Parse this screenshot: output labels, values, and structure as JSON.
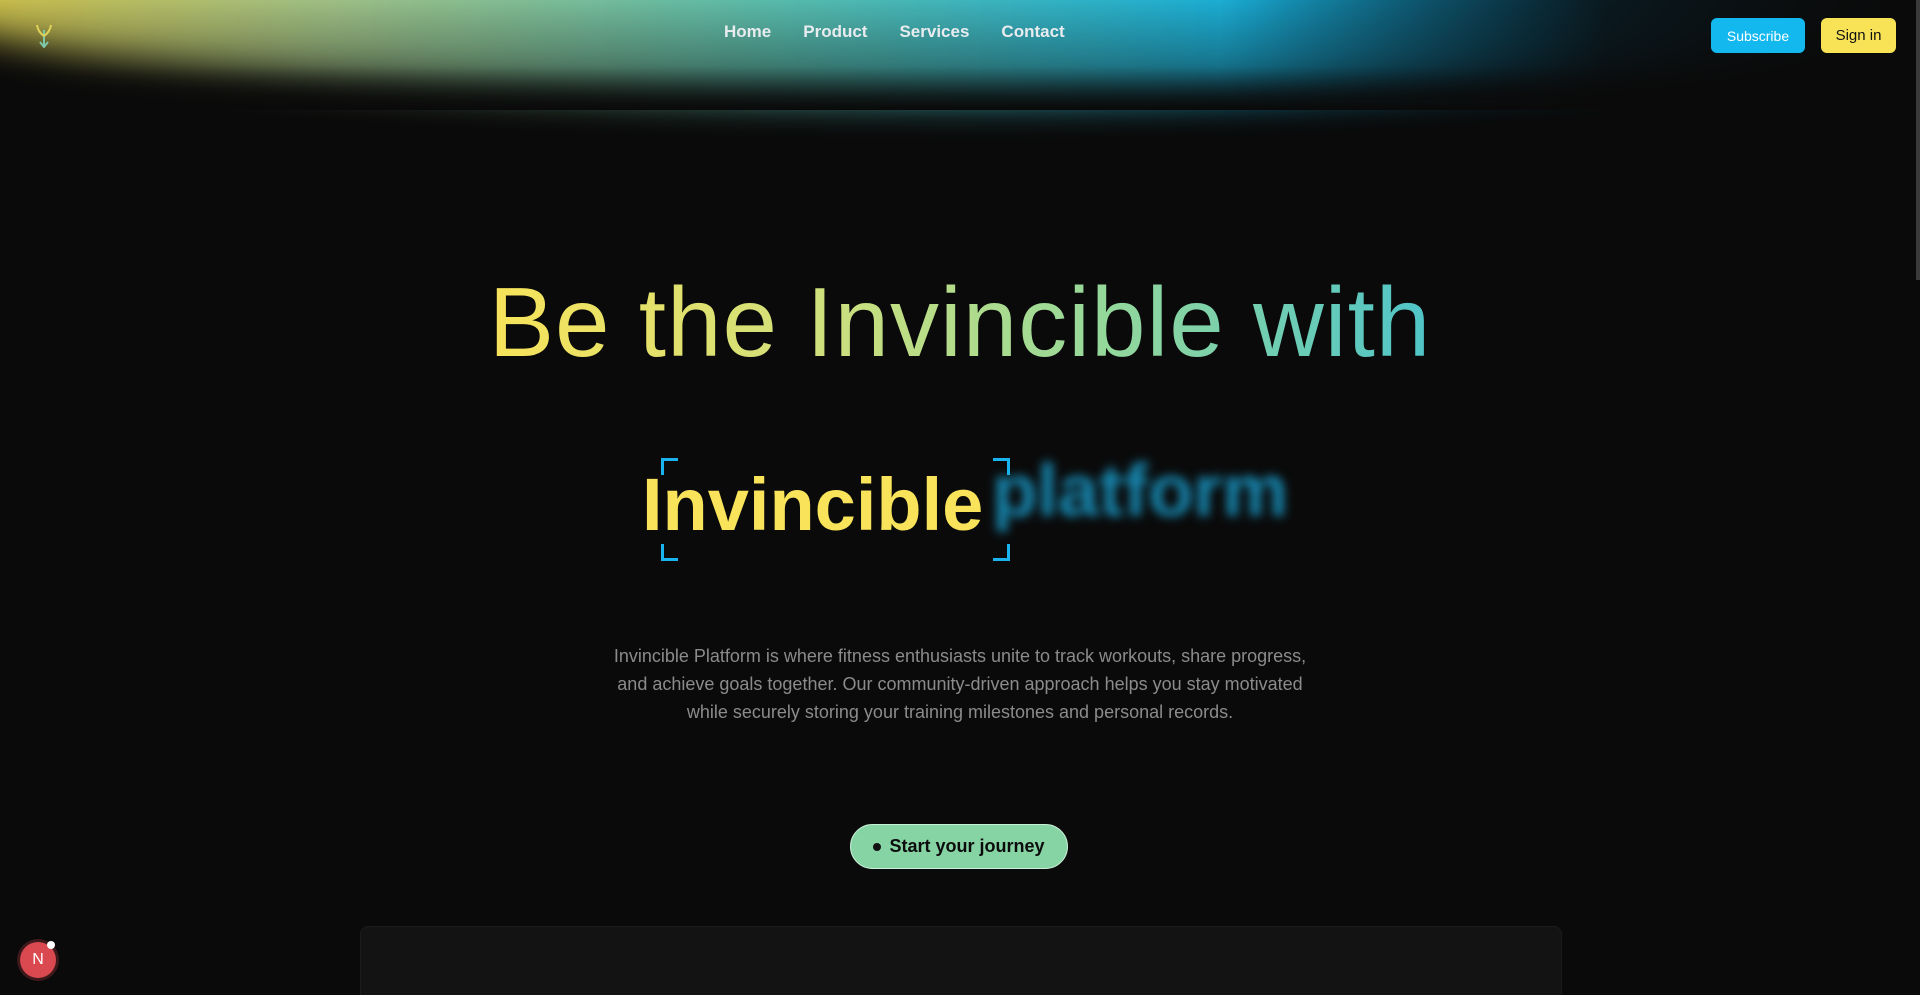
{
  "nav": {
    "logo_icon": "sprout-arrow-icon",
    "links": [
      "Home",
      "Product",
      "Services",
      "Contact"
    ],
    "subscribe_label": "Subscribe",
    "signin_label": "Sign in"
  },
  "hero": {
    "title": "Be the Invincible with",
    "rotating_word_active": "Invincible",
    "rotating_word_next": "platform",
    "description": "Invincible Platform is where fitness enthusiasts unite to track workouts, share progress, and achieve goals together. Our community-driven approach helps you stay motivated while securely storing your training milestones and personal records.",
    "cta_label": "Start your journey"
  },
  "badge": {
    "letter": "N"
  },
  "colors": {
    "background": "#0a0a0a",
    "accent_yellow": "#f8e35a",
    "accent_cyan": "#13b8ef",
    "accent_green": "#86d3a4"
  }
}
